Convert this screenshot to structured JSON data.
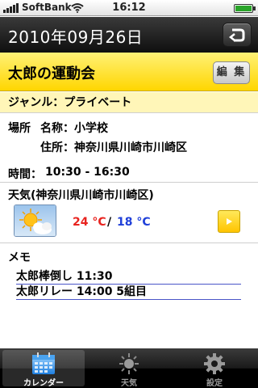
{
  "status_bar": {
    "carrier": "SoftBank",
    "time": "16:12",
    "battery_level": 1.0
  },
  "nav": {
    "title": "2010年09月26日",
    "back_icon": "return-arrow-icon"
  },
  "event": {
    "title": "太郎の運動会",
    "edit_label": "編 集"
  },
  "genre": "ジャンル：プライベート",
  "place": {
    "label": "場所",
    "name_label": "名称：",
    "name_value": "小学校",
    "address_label": "住所：",
    "address_value": "神奈川県川崎市川崎区"
  },
  "time": {
    "label": "時間：",
    "value": "10:30 - 16:30"
  },
  "weather": {
    "label": "天気(神奈川県川崎市川崎区)",
    "high": "24 °C",
    "separator": "/",
    "low": "18 °C",
    "icon": "sun-cloud-icon"
  },
  "memo": {
    "label": "メモ",
    "lines": [
      "太郎棒倒し 11:30",
      "太郎リレー 14:00  5組目"
    ]
  },
  "tabs": [
    {
      "label": "カレンダー",
      "icon": "calendar-icon",
      "selected": true
    },
    {
      "label": "天気",
      "icon": "weather-icon",
      "selected": false
    },
    {
      "label": "設定",
      "icon": "gear-icon",
      "selected": false
    }
  ],
  "colors": {
    "accent_yellow": "#ffd600",
    "temp_high": "#e8231f",
    "temp_low": "#1f3fd9",
    "memo_underline": "#4a56c8"
  }
}
